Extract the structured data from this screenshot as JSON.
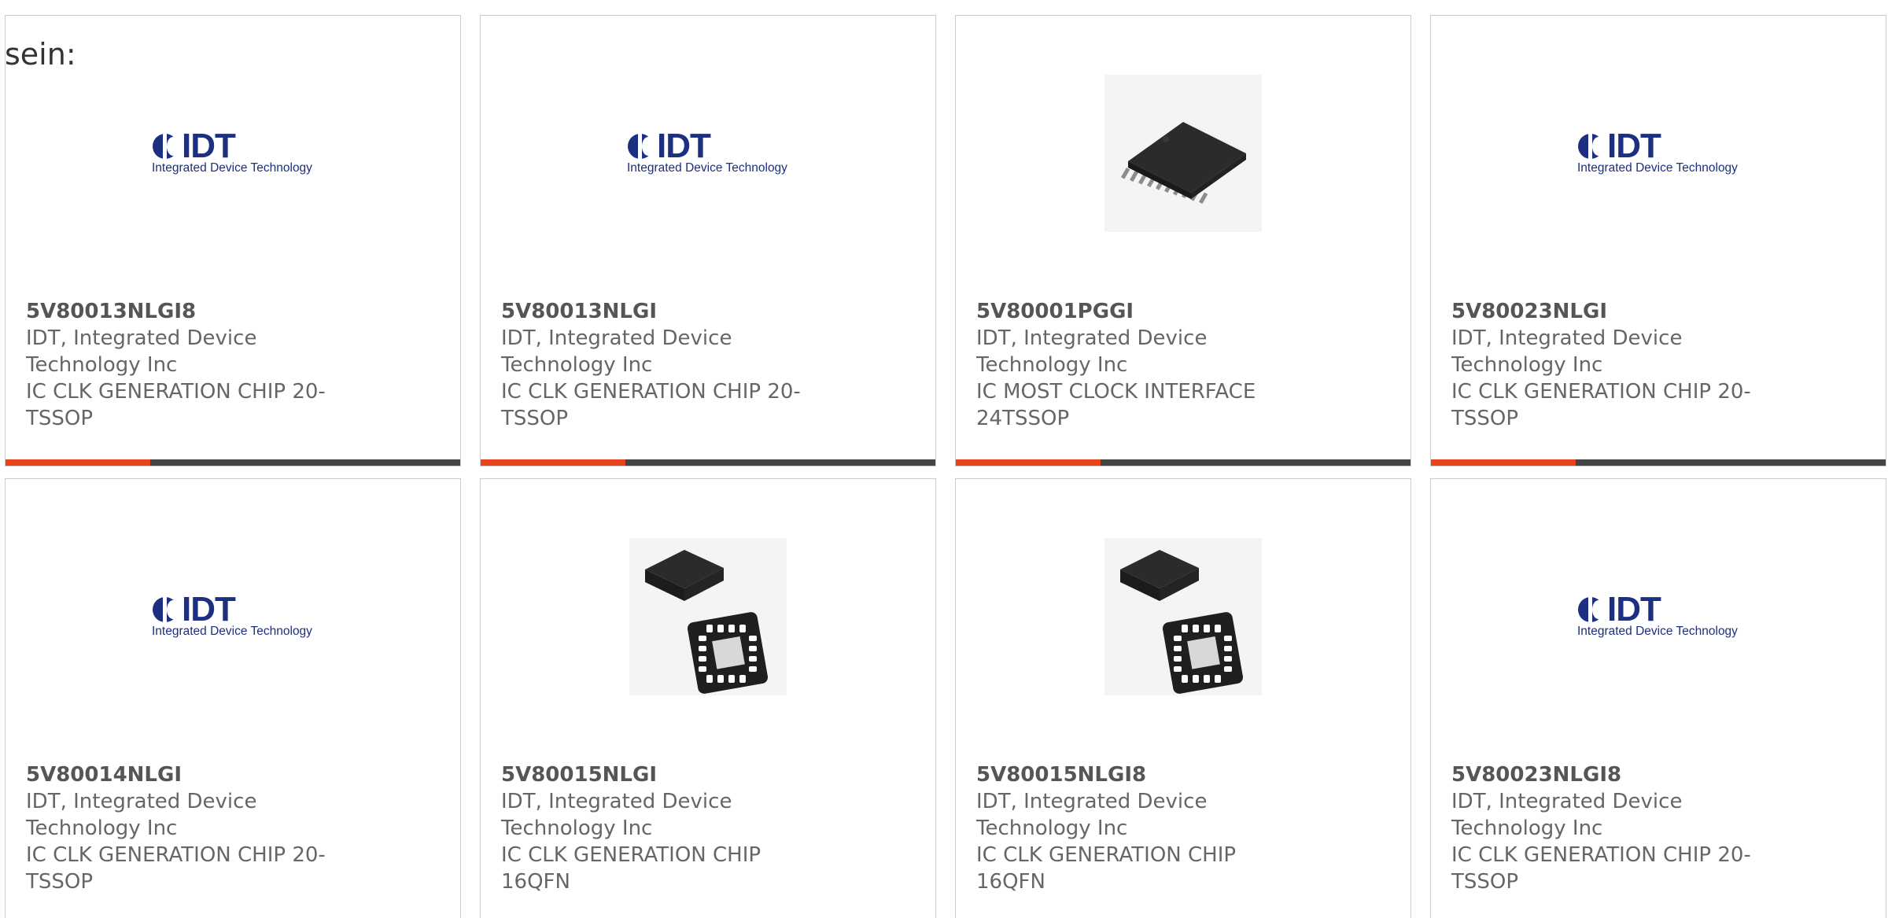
{
  "intro_text": "sein:",
  "colors": {
    "accent": "#e8431a",
    "bar": "#444444",
    "logo_blue": "#1c2f80"
  },
  "logo": {
    "wordmark": "IDT",
    "tagline": "Integrated Device Technology"
  },
  "products": [
    {
      "part": "5V80013NLGI8",
      "manufacturer": "IDT, Integrated Device Technology Inc",
      "description": "IC CLK GENERATION CHIP 20-TSSOP",
      "image": "idt-logo"
    },
    {
      "part": "5V80013NLGI",
      "manufacturer": "IDT, Integrated Device Technology Inc",
      "description": "IC CLK GENERATION CHIP 20-TSSOP",
      "image": "idt-logo"
    },
    {
      "part": "5V80001PGGI",
      "manufacturer": "IDT, Integrated Device Technology Inc",
      "description": "IC MOST CLOCK INTERFACE 24TSSOP",
      "image": "tssop-chip-photo"
    },
    {
      "part": "5V80023NLGI",
      "manufacturer": "IDT, Integrated Device Technology Inc",
      "description": "IC CLK GENERATION CHIP 20-TSSOP",
      "image": "idt-logo"
    },
    {
      "part": "5V80014NLGI",
      "manufacturer": "IDT, Integrated Device Technology Inc",
      "description": "IC CLK GENERATION CHIP 20-TSSOP",
      "image": "idt-logo"
    },
    {
      "part": "5V80015NLGI",
      "manufacturer": "IDT, Integrated Device Technology Inc",
      "description": "IC CLK GENERATION CHIP 16QFN",
      "image": "qfn-chip-photo"
    },
    {
      "part": "5V80015NLGI8",
      "manufacturer": "IDT, Integrated Device Technology Inc",
      "description": "IC CLK GENERATION CHIP 16QFN",
      "image": "qfn-chip-photo"
    },
    {
      "part": "5V80023NLGI8",
      "manufacturer": "IDT, Integrated Device Technology Inc",
      "description": "IC CLK GENERATION CHIP 20-TSSOP",
      "image": "idt-logo"
    }
  ]
}
